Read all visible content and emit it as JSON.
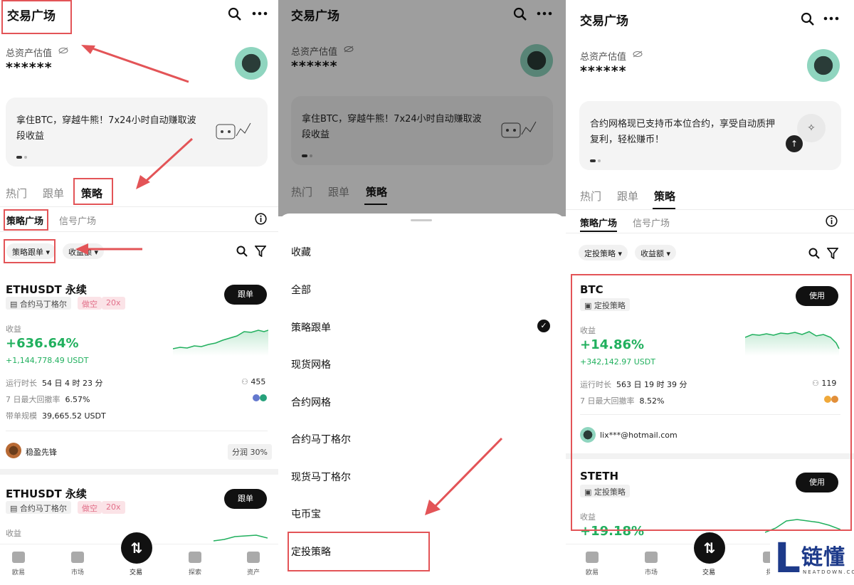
{
  "screen1": {
    "title": "交易广场",
    "asset_label": "总资产估值",
    "asset_value": "******",
    "banner_text": "拿住BTC，穿越牛熊！7x24小时自动赚取波段收益",
    "tabs": [
      "热门",
      "跟单",
      "策略"
    ],
    "subtabs": [
      "策略广场",
      "信号广场"
    ],
    "filters": [
      "策略跟单 ▾",
      "收益额 ▾"
    ],
    "card": {
      "title": "ETHUSDT 永续",
      "tag_type": "合约马丁格尔",
      "tag_side": "做空",
      "tag_lev": "20x",
      "button": "跟单",
      "profit_label": "收益",
      "profit_pct": "+636.64%",
      "profit_usdt": "+1,144,778.49 USDT",
      "run_label": "运行时长",
      "run_value": "54 日 4 时 23 分",
      "followers": "455",
      "dd_label": "7 日最大回撤率",
      "dd_value": "6.57%",
      "scale_label": "带单规模",
      "scale_value": "39,665.52 USDT",
      "user": "稳盈先锋",
      "split": "分润 30%"
    },
    "card2": {
      "title": "ETHUSDT 永续",
      "tag_type": "合约马丁格尔",
      "tag_side": "做空",
      "tag_lev": "20x",
      "button": "跟单",
      "profit_label": "收益"
    },
    "nav": [
      "欧易",
      "市场",
      "交易",
      "探索",
      "资产"
    ]
  },
  "screen2": {
    "title": "交易广场",
    "asset_label": "总资产估值",
    "asset_value": "******",
    "banner_text": "拿住BTC，穿越牛熊！7x24小时自动赚取波段收益",
    "tabs": [
      "热门",
      "跟单",
      "策略"
    ],
    "menu": [
      "收藏",
      "全部",
      "策略跟单",
      "现货网格",
      "合约网格",
      "合约马丁格尔",
      "现货马丁格尔",
      "屯币宝",
      "定投策略"
    ],
    "checked_index": 2
  },
  "screen3": {
    "title": "交易广场",
    "asset_label": "总资产估值",
    "asset_value": "******",
    "banner_text": "合约网格现已支持币本位合约，享受自动质押复利，轻松赚币！",
    "tabs": [
      "热门",
      "跟单",
      "策略"
    ],
    "subtabs": [
      "策略广场",
      "信号广场"
    ],
    "filters": [
      "定投策略 ▾",
      "收益额 ▾"
    ],
    "card": {
      "title": "BTC",
      "tag": "定投策略",
      "button": "使用",
      "profit_label": "收益",
      "profit_pct": "+14.86%",
      "profit_usdt": "+342,142.97 USDT",
      "run_label": "运行时长",
      "run_value": "563 日 19 时 39 分",
      "followers": "119",
      "dd_label": "7 日最大回撤率",
      "dd_value": "8.52%",
      "user": "lix***@hotmail.com"
    },
    "card2": {
      "title": "STETH",
      "tag": "定投策略",
      "button": "使用",
      "profit_label": "收益",
      "profit_pct": "+19.18%"
    },
    "nav": [
      "欧易",
      "市场",
      "交易",
      "探"
    ]
  },
  "watermark": {
    "letter": "L",
    "cn": "链懂",
    "en": "NEATDOWN.COM"
  },
  "colors": {
    "accent_red": "#e35457",
    "profit_green": "#21b05e",
    "brand_blue": "#1d3a8a"
  }
}
